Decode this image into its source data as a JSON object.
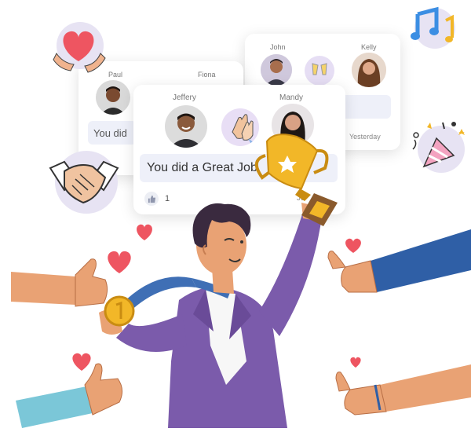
{
  "back_right_card": {
    "left_name": "John",
    "right_name": "Kelly",
    "date": "Yesterday"
  },
  "back_left_card": {
    "left_name": "Paul",
    "right_name": "Fiona",
    "message": "You did"
  },
  "front_card": {
    "left_name": "Jeffery",
    "right_name": "Mandy",
    "message": "You did a Great Job",
    "like_count": "1",
    "date": "Ju"
  },
  "colors": {
    "accent_purple": "#7b5bab",
    "ribbon_blue": "#3f6fb5",
    "gold": "#f2b728",
    "heart_red": "#ee5561",
    "skin": "#e9a274"
  }
}
